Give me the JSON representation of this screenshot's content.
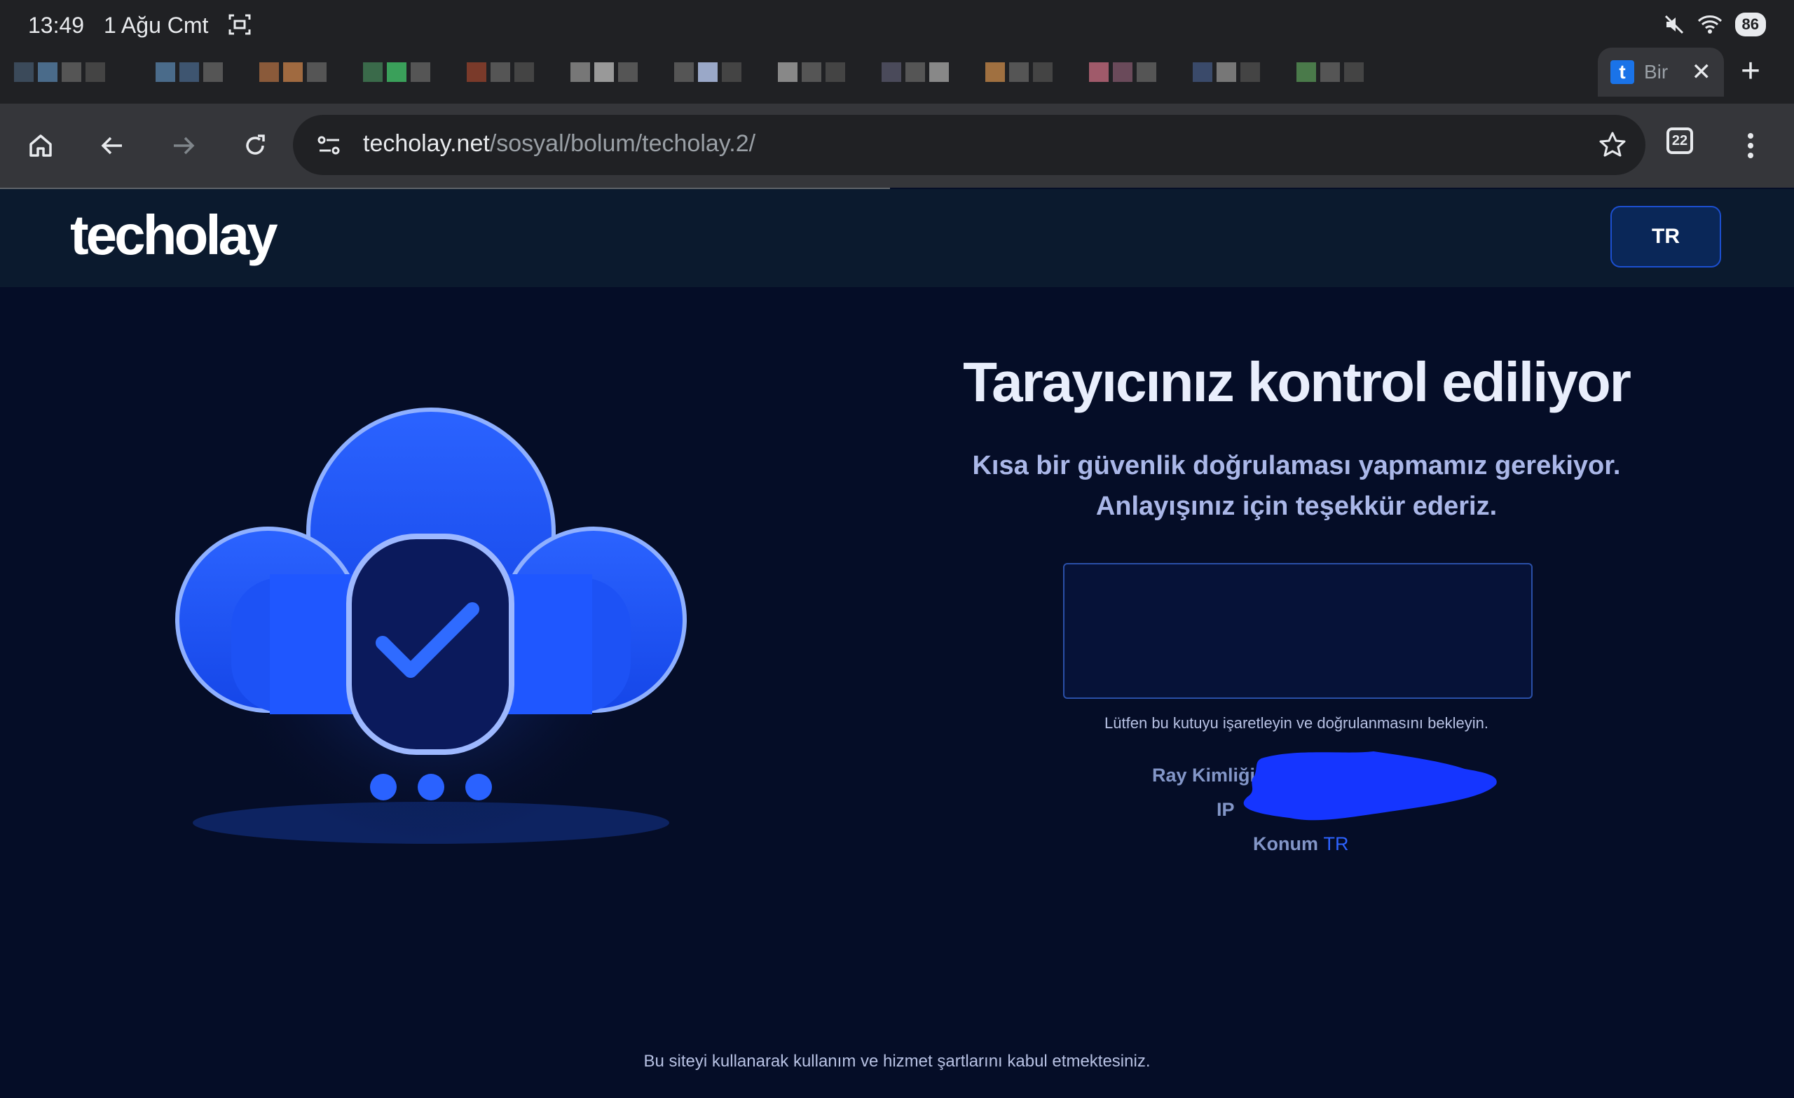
{
  "status_bar": {
    "time": "13:49",
    "date": "1 Ağu Cmt",
    "battery": "86"
  },
  "tabs": {
    "active_title": "Bir",
    "favicon_letter": "t"
  },
  "toolbar": {
    "url_domain": "techolay.net",
    "url_path": "/sosyal/bolum/techolay.2/",
    "tab_count": "22"
  },
  "site": {
    "logo": "techolay",
    "lang_button": "TR"
  },
  "main": {
    "title": "Tarayıcınız kontrol ediliyor",
    "subtitle_line1": "Kısa bir güvenlik doğrulaması yapmamız gerekiyor.",
    "subtitle_line2": "Anlayışınız için teşekkür ederiz.",
    "hint": "Lütfen bu kutuyu işaretleyin ve doğrulanmasını bekleyin.",
    "ray_label": "Ray Kimliği",
    "ip_label": "IP",
    "location_label": "Konum",
    "location_value": "TR"
  },
  "footer": {
    "text": "Bu siteyi kullanarak kullanım ve hizmet şartlarını kabul etmektesiniz."
  },
  "colors": {
    "page_bg": "#050d27",
    "header_bg": "#0b1a2e",
    "accent": "#2d62ff",
    "cloud": "#1f57ff"
  }
}
